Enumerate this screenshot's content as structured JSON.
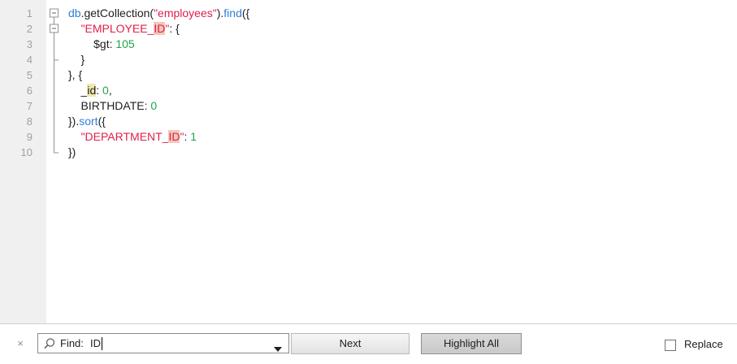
{
  "editor": {
    "lines": [
      {
        "num": "1",
        "tokens": [
          [
            "fn",
            "db"
          ],
          [
            "plain",
            "."
          ],
          [
            "plain",
            "getCollection("
          ],
          [
            "str",
            "\"employees\""
          ],
          [
            "plain",
            ")."
          ],
          [
            "fn",
            "find"
          ],
          [
            "plain",
            "({"
          ]
        ]
      },
      {
        "num": "2",
        "tokens": [
          [
            "plain",
            "    "
          ],
          [
            "key",
            "\"EMPLOYEE_"
          ],
          [
            "hlkey",
            "ID"
          ],
          [
            "key",
            "\""
          ],
          [
            "plain",
            ": {"
          ]
        ]
      },
      {
        "num": "3",
        "tokens": [
          [
            "plain",
            "        $gt: "
          ],
          [
            "num",
            "105"
          ]
        ]
      },
      {
        "num": "4",
        "tokens": [
          [
            "plain",
            "    }"
          ]
        ]
      },
      {
        "num": "5",
        "tokens": [
          [
            "plain",
            "}, {"
          ]
        ]
      },
      {
        "num": "6",
        "tokens": [
          [
            "plain",
            "    _"
          ],
          [
            "hlplain",
            "id"
          ],
          [
            "plain",
            ": "
          ],
          [
            "num",
            "0"
          ],
          [
            "plain",
            ","
          ]
        ]
      },
      {
        "num": "7",
        "tokens": [
          [
            "plain",
            "    BIRTHDATE: "
          ],
          [
            "num",
            "0"
          ]
        ]
      },
      {
        "num": "8",
        "tokens": [
          [
            "plain",
            "})."
          ],
          [
            "fn",
            "sort"
          ],
          [
            "plain",
            "({"
          ]
        ]
      },
      {
        "num": "9",
        "tokens": [
          [
            "plain",
            "    "
          ],
          [
            "key",
            "\"DEPARTMENT_"
          ],
          [
            "hlkey",
            "ID"
          ],
          [
            "key",
            "\""
          ],
          [
            "plain",
            ": "
          ],
          [
            "num",
            "1"
          ]
        ]
      },
      {
        "num": "10",
        "tokens": [
          [
            "plain",
            "})"
          ]
        ]
      }
    ]
  },
  "findbar": {
    "close_label": "×",
    "find_label": "Find:",
    "find_value": "ID",
    "next_label": "Next",
    "highlight_all_label": "Highlight All",
    "replace_label": "Replace",
    "replace_checked": false
  },
  "colors": {
    "function": "#2f7fd6",
    "string": "#e0204a",
    "number": "#22a34a",
    "match_highlight": "#f3c7bb",
    "gutter": "#f0f0f0"
  }
}
